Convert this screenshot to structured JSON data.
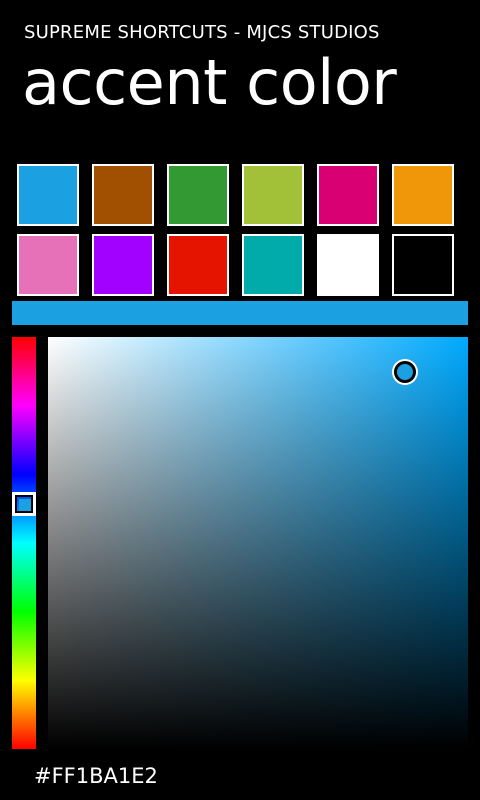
{
  "header": {
    "app_title": "SUPREME SHORTCUTS - MJCS STUDIOS",
    "page_title": "accent color"
  },
  "palette": {
    "swatches": [
      {
        "color": "#1ba1e2"
      },
      {
        "color": "#a05000"
      },
      {
        "color": "#339933"
      },
      {
        "color": "#a2c139"
      },
      {
        "color": "#d80073"
      },
      {
        "color": "#f09609"
      },
      {
        "color": "#e671b8"
      },
      {
        "color": "#a200ff"
      },
      {
        "color": "#e51400"
      },
      {
        "color": "#00aba9"
      },
      {
        "color": "#ffffff"
      },
      {
        "color": "#000000"
      }
    ]
  },
  "picker": {
    "preview_color": "#1ba1e2",
    "hue_selected_color": "#1ba1e2",
    "field_hue_color": "#00aaff"
  },
  "footer": {
    "hex_value": "#FF1BA1E2"
  }
}
